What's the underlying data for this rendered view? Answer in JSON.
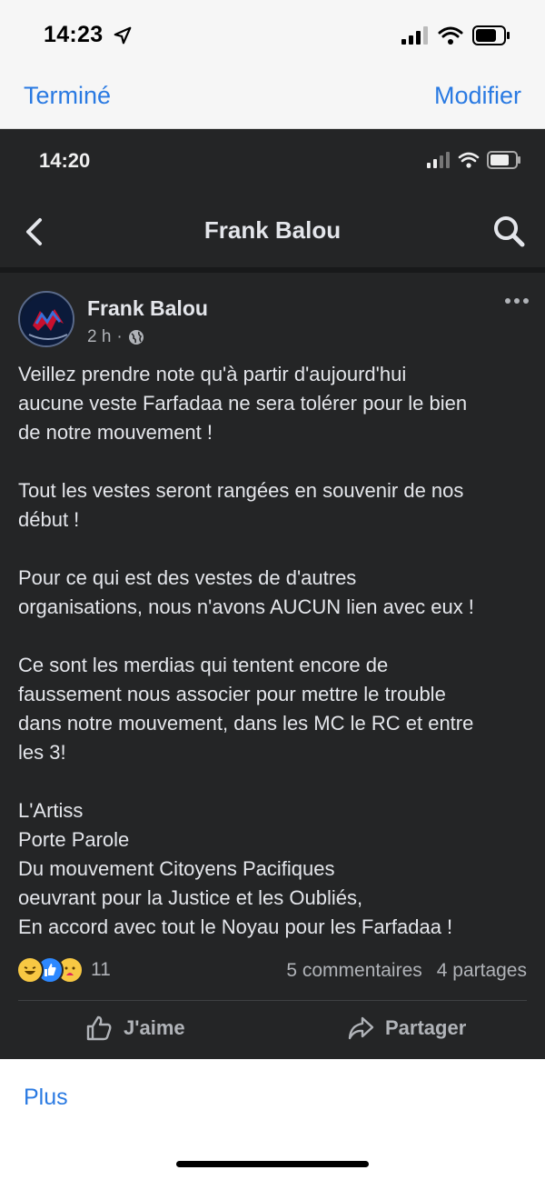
{
  "ios": {
    "time": "14:23"
  },
  "viewer": {
    "done_label": "Terminé",
    "edit_label": "Modifier",
    "more_label": "Plus"
  },
  "screenshot": {
    "status_time": "14:20",
    "header_title": "Frank Balou",
    "post": {
      "author": "Frank Balou",
      "time_ago": "2 h",
      "separator": "·",
      "paragraphs": [
        [
          "Veillez prendre note qu'à partir d'aujourd'hui",
          "aucune veste Farfadaa ne sera tolérer pour le bien",
          "de notre mouvement !"
        ],
        [
          "Tout les vestes seront rangées en souvenir de nos",
          "début !"
        ],
        [
          "Pour ce qui est des vestes de d'autres",
          "organisations, nous n'avons AUCUN lien avec eux !"
        ],
        [
          "Ce sont les merdias qui tentent encore de",
          "faussement nous associer pour mettre le trouble",
          "dans notre mouvement, dans les MC le RC et entre",
          "les 3!"
        ],
        [
          "L'Artiss",
          "Porte Parole",
          "Du mouvement Citoyens Pacifiques",
          "oeuvrant pour la Justice et les Oubliés,",
          "En accord avec tout le Noyau pour les Farfadaa !"
        ]
      ],
      "reaction_count": "11",
      "comments": "5 commentaires",
      "shares": "4 partages",
      "like_label": "J'aime",
      "share_label": "Partager"
    }
  },
  "colors": {
    "ios_blue": "#2a7ae2",
    "fb_dark_bg": "#242526",
    "fb_text": "#e4e6eb",
    "fb_secondary": "#b0b3b8"
  },
  "icons": {
    "location": "location-arrow-icon",
    "signal": "signal-bars-icon",
    "wifi": "wifi-icon",
    "battery": "battery-icon",
    "back": "chevron-left-icon",
    "search": "search-icon",
    "globe": "globe-icon",
    "more": "more-horizontal-icon",
    "like": "thumbs-up-icon",
    "share": "share-arrow-icon"
  }
}
